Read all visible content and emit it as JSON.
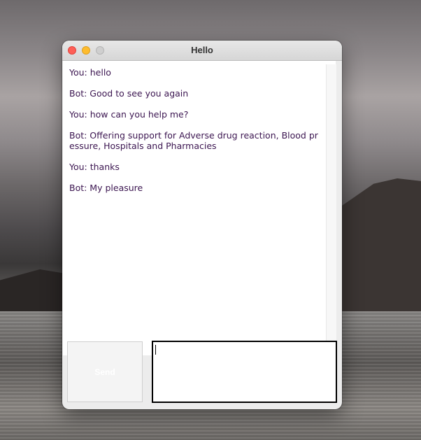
{
  "window": {
    "title": "Hello"
  },
  "messages": [
    "You: hello",
    "Bot: Good to see you again",
    "You: how can you help me?",
    "Bot: Offering support for Adverse drug reaction, Blood pressure, Hospitals and Pharmacies",
    "You: thanks",
    "Bot: My pleasure"
  ],
  "send_button": {
    "label": "Send"
  },
  "input": {
    "value": ""
  }
}
